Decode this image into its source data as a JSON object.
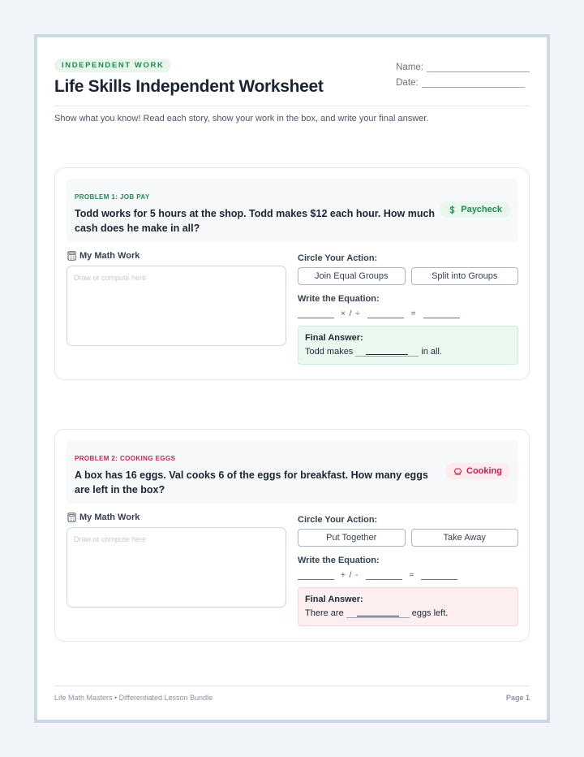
{
  "header": {
    "badge": "INDEPENDENT WORK",
    "title": "Life Skills Independent Worksheet",
    "name_label": "Name:",
    "date_label": "Date:"
  },
  "instructions": "Show what you know! Read each story, show your work in the box, and write your final answer.",
  "problems": [
    {
      "label": "PROBLEM 1: JOB PAY",
      "text": "Todd works for 5 hours at the shop. Todd makes $12 each hour. How much cash does he make in all?",
      "tag": "Paycheck",
      "tag_icon": "dollar-icon",
      "work_label": "My Math Work",
      "work_placeholder": "Draw or compute here",
      "action_label": "Circle Your Action:",
      "actions": [
        "Join Equal Groups",
        "Split into Groups"
      ],
      "equation_label": "Write the Equation:",
      "operators": "× / ÷",
      "equals": "=",
      "answer_label": "Final Answer:",
      "answer_prefix": "Todd makes",
      "answer_suffix": "in all.",
      "color": "#1f8a52"
    },
    {
      "label": "PROBLEM 2: COOKING EGGS",
      "text": "A box has 16 eggs. Val cooks 6 of the eggs for breakfast. How many eggs are left in the box?",
      "tag": "Cooking",
      "tag_icon": "chef-hat-icon",
      "work_label": "My Math Work",
      "work_placeholder": "Draw or compute here",
      "action_label": "Circle Your Action:",
      "actions": [
        "Put Together",
        "Take Away"
      ],
      "equation_label": "Write the Equation:",
      "operators": "+ / -",
      "equals": "=",
      "answer_label": "Final Answer:",
      "answer_prefix": "There are",
      "answer_suffix": "eggs left.",
      "color": "#c8224e"
    }
  ],
  "footer": {
    "left": "Life Math Masters • Differentiated Lesson Bundle",
    "right": "Page 1"
  }
}
